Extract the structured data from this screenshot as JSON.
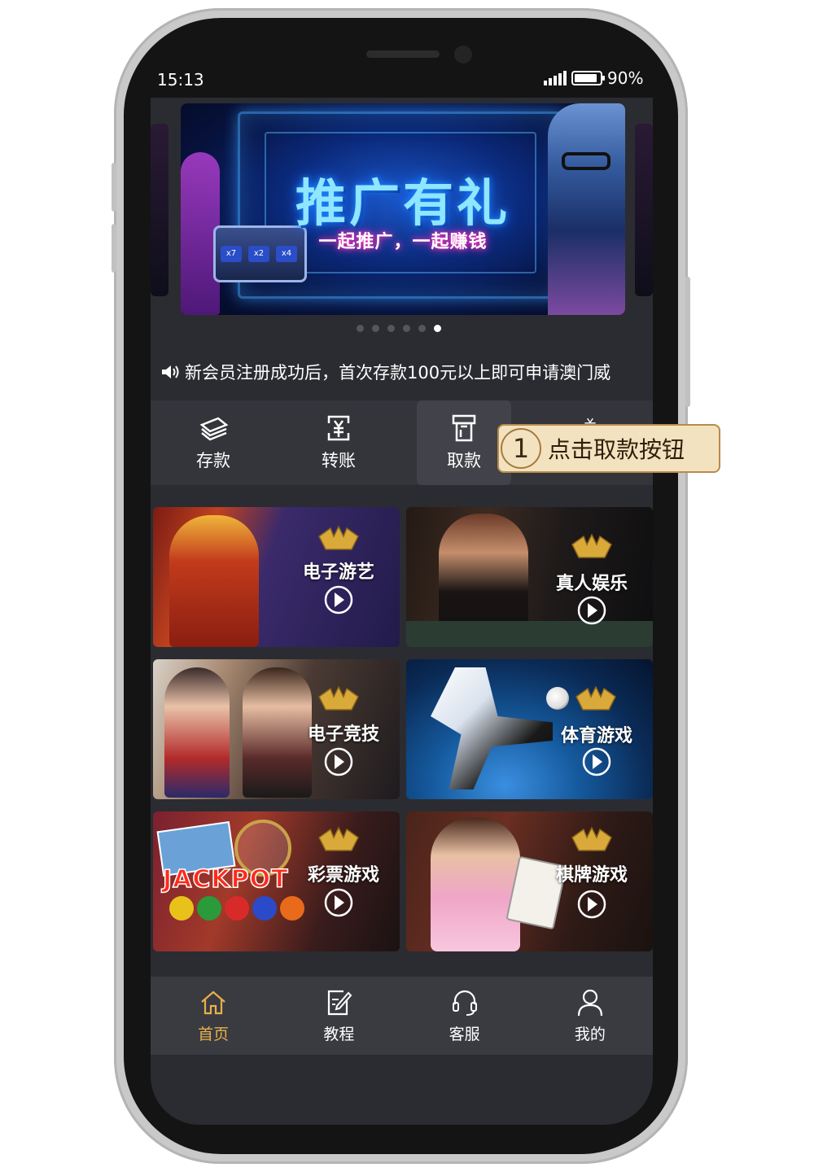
{
  "status_bar": {
    "time": "15:13",
    "battery": "90%"
  },
  "banner": {
    "title": "推广有礼",
    "subtitle": "一起推广，一起赚钱",
    "slot_labels": [
      "x7",
      "x2",
      "x4"
    ],
    "page_count": 6,
    "active_page": 6
  },
  "notice": {
    "text": "新会员注册成功后，首次存款100元以上即可申请澳门威"
  },
  "actions": [
    {
      "label": "存款",
      "icon": "cash-stack-icon"
    },
    {
      "label": "转账",
      "icon": "yuan-transfer-icon"
    },
    {
      "label": "取款",
      "icon": "atm-withdraw-icon"
    }
  ],
  "callout": {
    "number": "1",
    "text": "点击取款按钮"
  },
  "games": [
    {
      "label": "电子游艺",
      "icon": "lion-logo-icon"
    },
    {
      "label": "真人娱乐",
      "icon": "lion-logo-icon"
    },
    {
      "label": "电子竞技",
      "icon": "lion-logo-icon"
    },
    {
      "label": "体育游戏",
      "icon": "lion-logo-icon"
    },
    {
      "label": "彩票游戏",
      "icon": "lion-logo-icon",
      "art_text": "JACKPOT"
    },
    {
      "label": "棋牌游戏",
      "icon": "lion-logo-icon"
    }
  ],
  "tabbar": [
    {
      "label": "首页",
      "icon": "home-icon",
      "active": true
    },
    {
      "label": "教程",
      "icon": "edit-note-icon",
      "active": false
    },
    {
      "label": "客服",
      "icon": "headset-icon",
      "active": false
    },
    {
      "label": "我的",
      "icon": "user-icon",
      "active": false
    }
  ],
  "colors": {
    "accent": "#e6b04a",
    "screen_bg": "#2b2c31",
    "callout_bg": "#f3e2bf"
  }
}
